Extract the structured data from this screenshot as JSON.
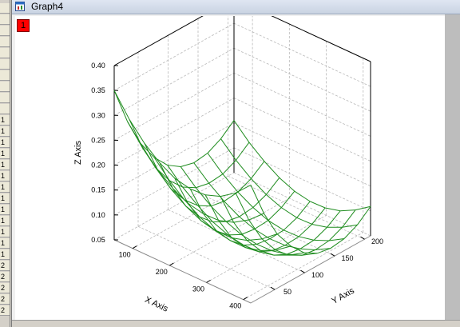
{
  "window": {
    "title": "Graph4",
    "layer_label": "1"
  },
  "left_panel": {
    "rows": [
      "",
      "",
      "",
      "",
      "",
      "",
      "",
      "",
      "",
      "",
      "1",
      "1",
      "1",
      "1",
      "1",
      "1",
      "1",
      "1",
      "1",
      "1",
      "1",
      "1",
      "1",
      "2",
      "2",
      "2",
      "2",
      "2"
    ]
  },
  "chart_data": {
    "type": "3d-wireframe",
    "xlabel": "X Axis",
    "ylabel": "Y Axis",
    "zlabel": "Z Axis",
    "xlim": [
      50,
      420
    ],
    "ylim": [
      10,
      210
    ],
    "zlim": [
      0.05,
      0.4
    ],
    "x_ticks": [
      100,
      200,
      300,
      400
    ],
    "y_ticks": [
      50,
      100,
      150,
      200
    ],
    "z_ticks": [
      "0.05",
      "0.10",
      "0.15",
      "0.20",
      "0.25",
      "0.30",
      "0.35",
      "0.40"
    ],
    "mesh_color": "#1e8c1e",
    "grid": true,
    "surface": {
      "x": [
        50,
        91,
        132,
        173,
        214,
        256,
        297,
        338,
        379,
        420
      ],
      "y": [
        10,
        32,
        54,
        77,
        99,
        121,
        143,
        166,
        188,
        210
      ],
      "z": [
        [
          0.35,
          0.273,
          0.214,
          0.17,
          0.14,
          0.122,
          0.115,
          0.119,
          0.133,
          0.155
        ],
        [
          0.306,
          0.234,
          0.179,
          0.138,
          0.11,
          0.094,
          0.088,
          0.091,
          0.104,
          0.125
        ],
        [
          0.272,
          0.204,
          0.151,
          0.113,
          0.087,
          0.071,
          0.066,
          0.069,
          0.081,
          0.101
        ],
        [
          0.247,
          0.181,
          0.13,
          0.093,
          0.068,
          0.054,
          0.049,
          0.052,
          0.063,
          0.082
        ],
        [
          0.23,
          0.165,
          0.115,
          0.08,
          0.056,
          0.042,
          0.038,
          0.04,
          0.051,
          0.069
        ],
        [
          0.223,
          0.158,
          0.109,
          0.074,
          0.05,
          0.037,
          0.033,
          0.035,
          0.045,
          0.063
        ],
        [
          0.225,
          0.159,
          0.109,
          0.074,
          0.051,
          0.038,
          0.034,
          0.036,
          0.046,
          0.064
        ],
        [
          0.236,
          0.169,
          0.118,
          0.082,
          0.058,
          0.045,
          0.041,
          0.043,
          0.054,
          0.072
        ],
        [
          0.257,
          0.188,
          0.135,
          0.097,
          0.072,
          0.057,
          0.053,
          0.056,
          0.068,
          0.088
        ],
        [
          0.287,
          0.215,
          0.159,
          0.119,
          0.091,
          0.075,
          0.07,
          0.074,
          0.087,
          0.109
        ]
      ]
    }
  }
}
